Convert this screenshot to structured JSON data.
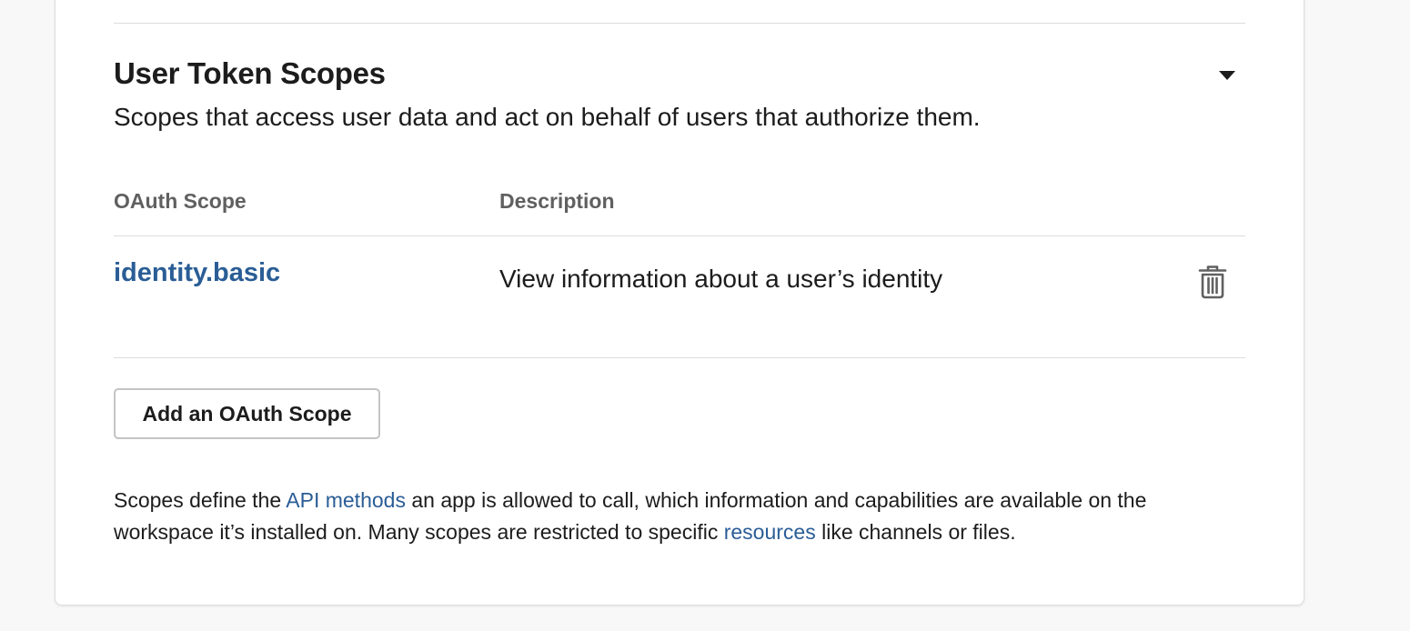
{
  "section": {
    "title": "User Token Scopes",
    "subtitle": "Scopes that access user data and act on behalf of users that authorize them."
  },
  "table": {
    "headers": {
      "scope": "OAuth Scope",
      "description": "Description"
    },
    "rows": [
      {
        "scope": "identity.basic",
        "description": "View information about a user’s identity",
        "action_icon": "trash-icon"
      }
    ]
  },
  "actions": {
    "add_scope_label": "Add an OAuth Scope"
  },
  "footnote": {
    "part1": "Scopes define the ",
    "link1": "API methods",
    "part2": " an app is allowed to call, which information and capabilities are available on the workspace it’s installed on. Many scopes are restricted to specific ",
    "link2": "resources",
    "part3": " like channels or files."
  },
  "icons": {
    "collapse": "caret-down-icon",
    "remove": "trash-icon"
  },
  "colors": {
    "link": "#2a5d96",
    "text": "#1d1c1d",
    "muted": "#616061",
    "divider": "#dddddd",
    "background": "#f8f8f8"
  }
}
